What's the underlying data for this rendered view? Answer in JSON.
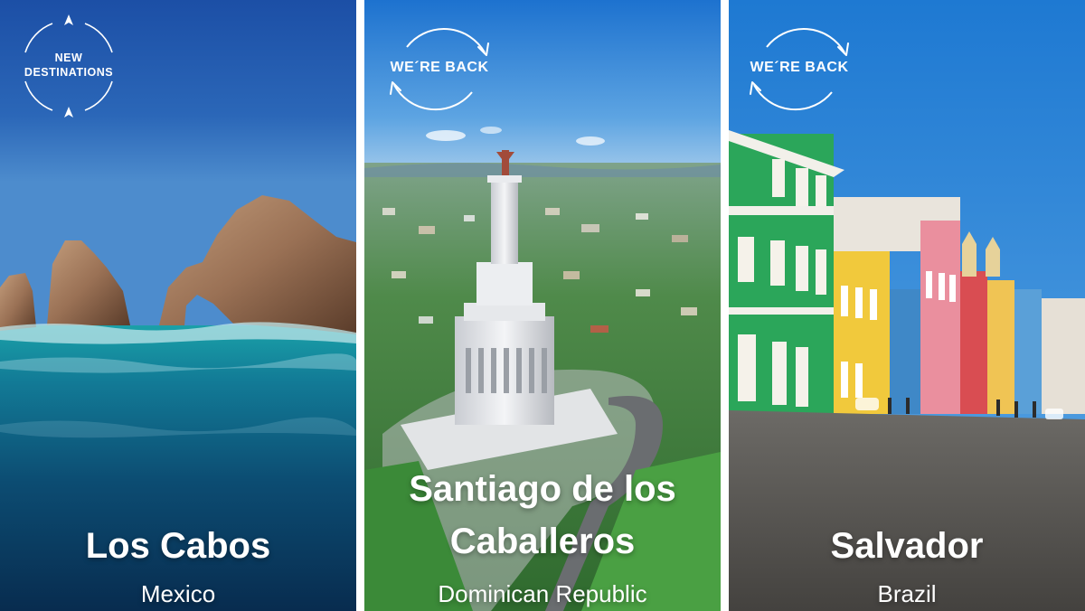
{
  "panels": [
    {
      "badge": {
        "line1": "NEW",
        "line2": "DESTINATIONS",
        "icon": "compass-circle-icon"
      },
      "title": "Los Cabos",
      "subtitle": "Mexico"
    },
    {
      "badge": {
        "text": "WE´RE BACK",
        "icon": "circular-arrows-icon"
      },
      "title_line1": "Santiago de los",
      "title_line2": "Caballeros",
      "subtitle": "Dominican Republic"
    },
    {
      "badge": {
        "text": "WE´RE BACK",
        "icon": "circular-arrows-icon"
      },
      "title": "Salvador",
      "subtitle": "Brazil"
    }
  ],
  "colors": {
    "text": "#ffffff",
    "divider": "#ffffff"
  }
}
